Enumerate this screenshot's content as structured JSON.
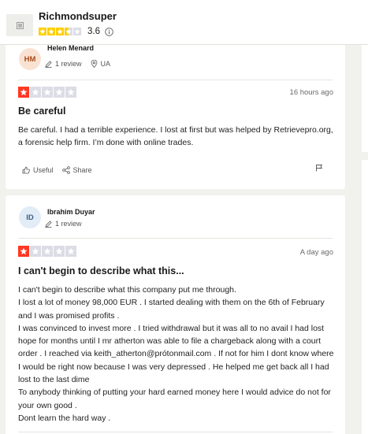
{
  "company": {
    "name": "Richmondsuper",
    "rating": "3.6",
    "stars": [
      {
        "color": "#ffce00",
        "fill": 1
      },
      {
        "color": "#ffce00",
        "fill": 1
      },
      {
        "color": "#ffce00",
        "fill": 1
      },
      {
        "color": "#ffce00",
        "fill": 0.5
      },
      {
        "color": "#dcdce6",
        "fill": 0
      }
    ]
  },
  "reviews": [
    {
      "initials": "HM",
      "name": "Helen Menard",
      "reviews_count": "1 review",
      "country": "UA",
      "star_rating": 1,
      "date": "16 hours ago",
      "title": "Be careful",
      "body": [
        "Be careful. I had a terrible experience. I lost at first but was helped by Retrievepro.org, a forensic help firm. I’m done with online trades."
      ],
      "useful_label": "Useful",
      "share_label": "Share"
    },
    {
      "initials": "ID",
      "name": "Ibrahim Duyar",
      "reviews_count": "1 review",
      "star_rating": 1,
      "date": "A day ago",
      "title": "I can't begin to describe what this...",
      "body": [
        "I can't begin to describe what this company put me through.",
        "I lost a lot of money 98,000 EUR . I started dealing with them on the 6th of February and I was promised profits .",
        "I was convinced to invest more . I tried withdrawal but it was all to no avail I had lost hope for months until I mr atherton was able to file a chargeback along with a court order . I reached via keith_atherton@prótonmail.com . If not for him I dont know where I would be right now because I was very depressed . He helped me get back all I had lost to the last dime",
        "To anybody thinking of putting your hard earned money here I would advice do not for your own good .",
        "Dont learn the hard way ."
      ]
    }
  ],
  "colors": {
    "star_filled": "#ff3722",
    "star_empty": "#dcdce6",
    "background": "#f1f1ed"
  }
}
